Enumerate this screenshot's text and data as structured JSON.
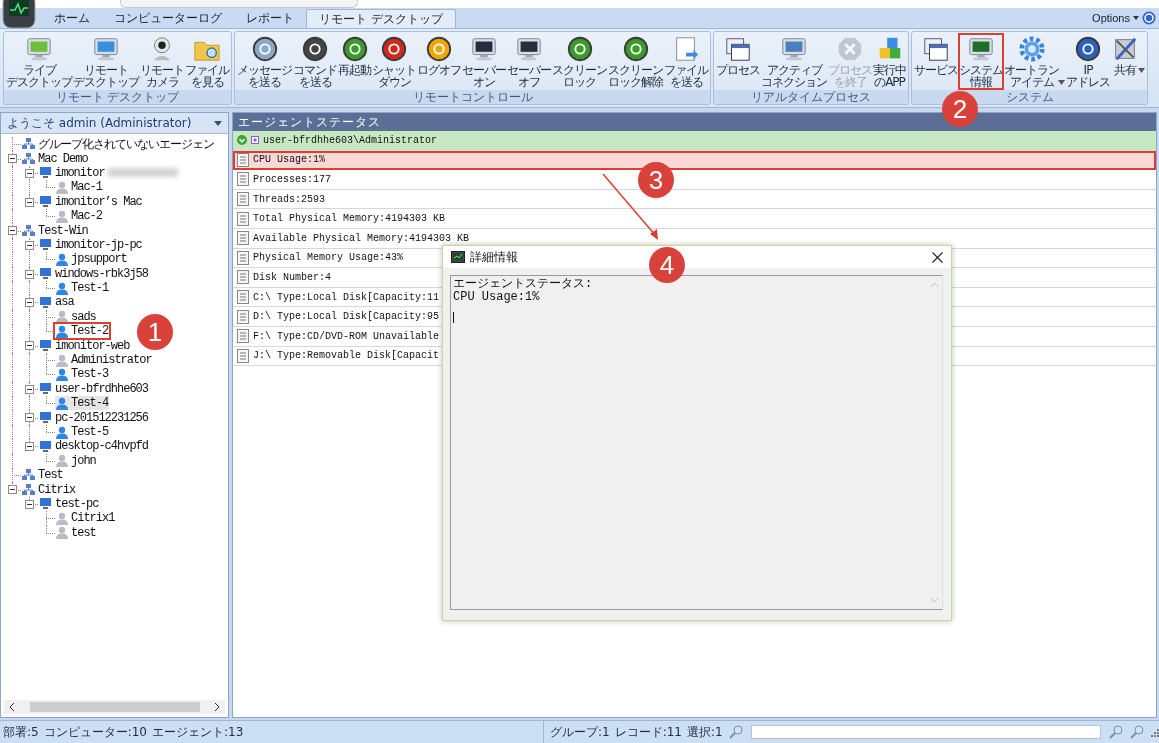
{
  "tabs": [
    {
      "label": "ホーム",
      "selected": false
    },
    {
      "label": "コンピューターログ",
      "selected": false
    },
    {
      "label": "レポート",
      "selected": false
    },
    {
      "label": "リモート デスクトップ",
      "selected": true
    }
  ],
  "options": {
    "label": "Options"
  },
  "ribbon": {
    "groups": [
      {
        "title": "リモート デスクトップ",
        "items": [
          {
            "lines": [
              "ライブ",
              "デスクトップ"
            ],
            "disabled": false,
            "highlighted": false,
            "has_menu": false
          },
          {
            "lines": [
              "リモート",
              "デスクトップ"
            ],
            "disabled": false,
            "highlighted": false,
            "has_menu": false
          },
          {
            "lines": [
              "リモート",
              "カメラ"
            ],
            "disabled": false,
            "highlighted": false,
            "has_menu": false
          },
          {
            "lines": [
              "ファイル",
              "を見る"
            ],
            "disabled": false,
            "highlighted": false,
            "has_menu": false
          }
        ]
      },
      {
        "title": "リモートコントロール",
        "items": [
          {
            "lines": [
              "メッセージ",
              "を送る"
            ],
            "disabled": false,
            "highlighted": false,
            "has_menu": false
          },
          {
            "lines": [
              "コマンド",
              "を送る"
            ],
            "disabled": false,
            "highlighted": false,
            "has_menu": false
          },
          {
            "lines": [
              "再起動"
            ],
            "disabled": false,
            "highlighted": false,
            "has_menu": false
          },
          {
            "lines": [
              "シャット",
              "ダウン"
            ],
            "disabled": false,
            "highlighted": false,
            "has_menu": false
          },
          {
            "lines": [
              "ログオフ"
            ],
            "disabled": false,
            "highlighted": false,
            "has_menu": false
          },
          {
            "lines": [
              "セーバー",
              "オン"
            ],
            "disabled": false,
            "highlighted": false,
            "has_menu": false
          },
          {
            "lines": [
              "セーバー",
              "オフ"
            ],
            "disabled": false,
            "highlighted": false,
            "has_menu": false
          },
          {
            "lines": [
              "スクリーン",
              "ロック"
            ],
            "disabled": false,
            "highlighted": false,
            "has_menu": false
          },
          {
            "lines": [
              "スクリーン",
              "ロック解除"
            ],
            "disabled": false,
            "highlighted": false,
            "has_menu": false
          },
          {
            "lines": [
              "ファイル",
              "を送る"
            ],
            "disabled": false,
            "highlighted": false,
            "has_menu": false
          }
        ]
      },
      {
        "title": "リアルタイムプロセス",
        "items": [
          {
            "lines": [
              "プロセス"
            ],
            "disabled": false,
            "highlighted": false,
            "has_menu": false
          },
          {
            "lines": [
              "アクティブ",
              "コネクション"
            ],
            "disabled": false,
            "highlighted": false,
            "has_menu": false
          },
          {
            "lines": [
              "プロセス",
              "を終了"
            ],
            "disabled": true,
            "highlighted": false,
            "has_menu": false
          },
          {
            "lines": [
              "実行中",
              "のAPP"
            ],
            "disabled": false,
            "highlighted": false,
            "has_menu": false
          }
        ]
      },
      {
        "title": "システム",
        "items": [
          {
            "lines": [
              "サービス"
            ],
            "disabled": false,
            "highlighted": false,
            "has_menu": false
          },
          {
            "lines": [
              "システム",
              "情報"
            ],
            "disabled": false,
            "highlighted": true,
            "has_menu": false
          },
          {
            "lines": [
              "オートラン",
              "アイテム"
            ],
            "disabled": false,
            "highlighted": false,
            "has_menu": true
          },
          {
            "lines": [
              "IP",
              "アドレス"
            ],
            "disabled": false,
            "highlighted": false,
            "has_menu": false
          },
          {
            "lines": [
              "共有"
            ],
            "disabled": false,
            "highlighted": false,
            "has_menu": true
          }
        ]
      }
    ]
  },
  "sidebar": {
    "title": "ようこそ admin (Administrator)",
    "tree": [
      {
        "label": "グループ化されていないエージェン",
        "kind": "group",
        "selected": false,
        "highlighted": false
      },
      {
        "label": "Mac Demo",
        "kind": "group",
        "selected": false,
        "highlighted": false,
        "expanded": true,
        "children": [
          {
            "label": "imonitor",
            "kind": "computer",
            "selected": false,
            "highlighted": false,
            "blurred": true,
            "expanded": true,
            "children": [
              {
                "label": "Mac-1",
                "kind": "user",
                "online": false,
                "selected": false,
                "highlighted": false
              }
            ]
          },
          {
            "label": "imonitor’s Mac",
            "kind": "computer",
            "selected": false,
            "highlighted": false,
            "expanded": true,
            "children": [
              {
                "label": "Mac-2",
                "kind": "user",
                "online": false,
                "selected": false,
                "highlighted": false
              }
            ]
          }
        ]
      },
      {
        "label": "Test-Win",
        "kind": "group",
        "selected": false,
        "highlighted": false,
        "expanded": true,
        "children": [
          {
            "label": "imonitor-jp-pc",
            "kind": "computer",
            "selected": false,
            "highlighted": false,
            "expanded": true,
            "children": [
              {
                "label": "jpsupport",
                "kind": "user",
                "online": true,
                "selected": false,
                "highlighted": false
              }
            ]
          },
          {
            "label": "windows-rbk3j58",
            "kind": "computer",
            "selected": false,
            "highlighted": false,
            "expanded": true,
            "children": [
              {
                "label": "Test-1",
                "kind": "user",
                "online": true,
                "selected": false,
                "highlighted": false
              }
            ]
          },
          {
            "label": "asa",
            "kind": "computer",
            "selected": false,
            "highlighted": false,
            "expanded": true,
            "children": [
              {
                "label": "sads",
                "kind": "user",
                "online": false,
                "selected": false,
                "highlighted": false
              },
              {
                "label": "Test-2",
                "kind": "user",
                "online": true,
                "selected": false,
                "highlighted": true
              }
            ]
          },
          {
            "label": "imonitor-web",
            "kind": "computer",
            "selected": false,
            "highlighted": false,
            "expanded": true,
            "children": [
              {
                "label": "Administrator",
                "kind": "user",
                "online": false,
                "selected": false,
                "highlighted": false
              },
              {
                "label": "Test-3",
                "kind": "user",
                "online": true,
                "selected": false,
                "highlighted": false
              }
            ]
          },
          {
            "label": "user-bfrdhhe603",
            "kind": "computer",
            "selected": false,
            "highlighted": false,
            "expanded": true,
            "children": [
              {
                "label": "Test-4",
                "kind": "user",
                "online": true,
                "selected": true,
                "highlighted": false
              }
            ]
          },
          {
            "label": "pc-201512231256",
            "kind": "computer",
            "selected": false,
            "highlighted": false,
            "expanded": true,
            "children": [
              {
                "label": "Test-5",
                "kind": "user",
                "online": true,
                "selected": false,
                "highlighted": false
              }
            ]
          },
          {
            "label": "desktop-c4hvpfd",
            "kind": "computer",
            "selected": false,
            "highlighted": false,
            "expanded": true,
            "children": [
              {
                "label": "john",
                "kind": "user",
                "online": false,
                "selected": false,
                "highlighted": false
              }
            ]
          }
        ]
      },
      {
        "label": "Test",
        "kind": "group",
        "selected": false,
        "highlighted": false
      },
      {
        "label": "Citrix",
        "kind": "group",
        "selected": false,
        "highlighted": false,
        "expanded": true,
        "children": [
          {
            "label": "test-pc",
            "kind": "computer",
            "selected": false,
            "highlighted": false,
            "expanded": true,
            "children": [
              {
                "label": "Citrix1",
                "kind": "user",
                "online": false,
                "selected": false,
                "highlighted": false
              },
              {
                "label": "test",
                "kind": "user",
                "online": false,
                "selected": false,
                "highlighted": false
              }
            ]
          }
        ]
      }
    ]
  },
  "status_panel": {
    "title": "エージェントステータス",
    "rows": [
      {
        "kind": "agent",
        "text": "user-bfrdhhe603\\Administrator",
        "selected": false,
        "highlighted": false
      },
      {
        "kind": "info",
        "text": "CPU Usage:1%",
        "selected": true,
        "highlighted": true
      },
      {
        "kind": "info",
        "text": "Processes:177",
        "selected": false,
        "highlighted": false
      },
      {
        "kind": "info",
        "text": "Threads:2593",
        "selected": false,
        "highlighted": false
      },
      {
        "kind": "info",
        "text": "Total Physical Memory:4194303 KB",
        "selected": false,
        "highlighted": false
      },
      {
        "kind": "info",
        "text": "Available Physical Memory:4194303 KB",
        "selected": false,
        "highlighted": false
      },
      {
        "kind": "info",
        "text": "Physical Memory Usage:43%",
        "selected": false,
        "highlighted": false
      },
      {
        "kind": "info",
        "text": "Disk Number:4",
        "selected": false,
        "highlighted": false
      },
      {
        "kind": "info",
        "text": "C:\\ Type:Local Disk[Capacity:11",
        "selected": false,
        "highlighted": false
      },
      {
        "kind": "info",
        "text": "D:\\ Type:Local Disk[Capacity:95",
        "selected": false,
        "highlighted": false
      },
      {
        "kind": "info",
        "text": "F:\\ Type:CD/DVD-ROM Unavailable",
        "selected": false,
        "highlighted": false
      },
      {
        "kind": "info",
        "text": "J:\\ Type:Removable Disk[Capacit",
        "selected": false,
        "highlighted": false
      }
    ]
  },
  "dialog": {
    "title": "詳細情報",
    "value": "エージェントステータス:\nCPU Usage:1%"
  },
  "annotations": [
    {
      "number": "1"
    },
    {
      "number": "2"
    },
    {
      "number": "3"
    },
    {
      "number": "4"
    }
  ],
  "status_bar": {
    "left": [
      "部署:5",
      "コンピューター:10",
      "エージェント:13"
    ],
    "right": [
      "グループ:1",
      "レコード:11",
      "選択:1"
    ]
  }
}
